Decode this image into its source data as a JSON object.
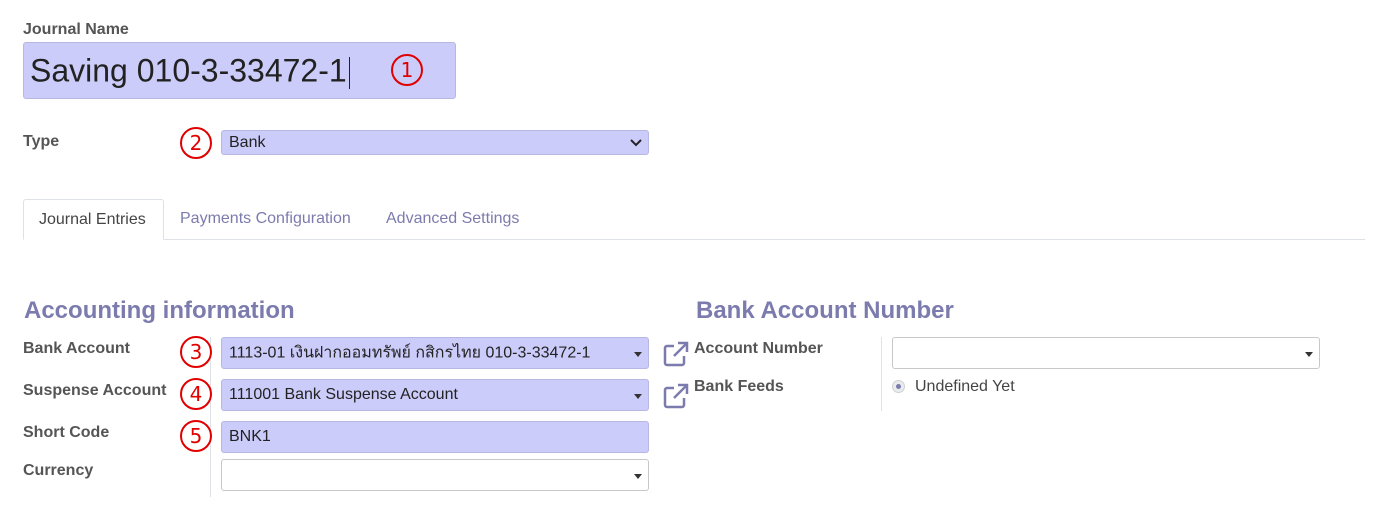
{
  "journal_name": {
    "label": "Journal Name",
    "value": "Saving 010-3-33472-1"
  },
  "type": {
    "label": "Type",
    "value": "Bank"
  },
  "tabs": [
    {
      "label": "Journal Entries",
      "active": true
    },
    {
      "label": "Payments Configuration",
      "active": false
    },
    {
      "label": "Advanced Settings",
      "active": false
    }
  ],
  "accounting": {
    "title": "Accounting information",
    "bank_account": {
      "label": "Bank Account",
      "value": "1113-01 เงินฝากออมทรัพย์ กสิกรไทย 010-3-33472-1"
    },
    "suspense_account": {
      "label": "Suspense Account",
      "value": "111001 Bank Suspense Account"
    },
    "short_code": {
      "label": "Short Code",
      "value": "BNK1"
    },
    "currency": {
      "label": "Currency",
      "value": ""
    }
  },
  "bank_account_number": {
    "title": "Bank Account Number",
    "account_number": {
      "label": "Account Number",
      "value": ""
    },
    "bank_feeds": {
      "label": "Bank Feeds",
      "option": "Undefined Yet"
    }
  },
  "annotations": [
    "1",
    "2",
    "3",
    "4",
    "5"
  ],
  "colors": {
    "field_bg": "#ccccfa",
    "accent": "#7c7bad",
    "annotation": "#e00000"
  }
}
